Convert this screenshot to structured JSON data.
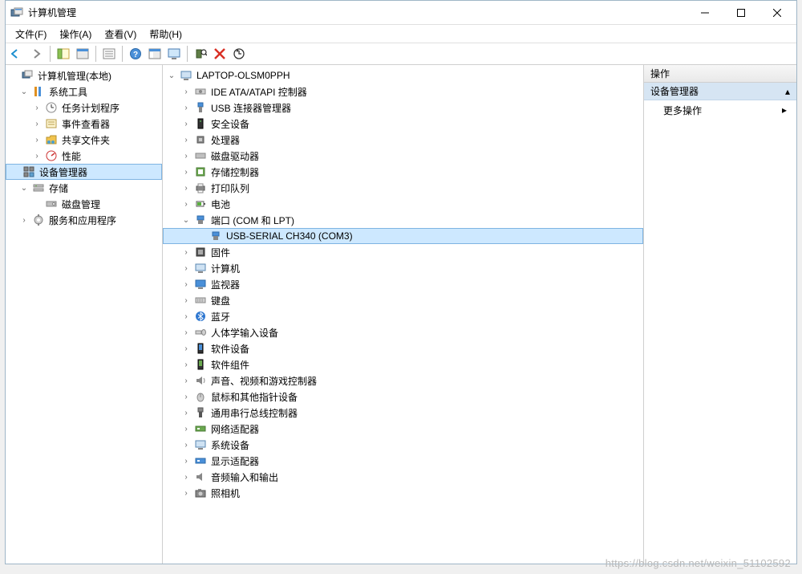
{
  "window": {
    "title": "计算机管理"
  },
  "menu": {
    "file": "文件(F)",
    "action": "操作(A)",
    "view": "查看(V)",
    "help": "帮助(H)"
  },
  "left_tree": {
    "root": "计算机管理(本地)",
    "system_tools": "系统工具",
    "task_scheduler": "任务计划程序",
    "event_viewer": "事件查看器",
    "shared_folders": "共享文件夹",
    "performance": "性能",
    "device_manager": "设备管理器",
    "storage": "存储",
    "disk_management": "磁盘管理",
    "services_apps": "服务和应用程序"
  },
  "device_tree": {
    "root": "LAPTOP-OLSM0PPH",
    "ide": "IDE ATA/ATAPI 控制器",
    "usb_connector": "USB 连接器管理器",
    "security_devices": "安全设备",
    "processors": "处理器",
    "disk_drives": "磁盘驱动器",
    "storage_controllers": "存储控制器",
    "print_queues": "打印队列",
    "batteries": "电池",
    "ports": "端口 (COM 和 LPT)",
    "usb_serial": "USB-SERIAL CH340 (COM3)",
    "firmware": "固件",
    "computer": "计算机",
    "monitors": "监视器",
    "keyboards": "键盘",
    "bluetooth": "蓝牙",
    "hid": "人体学输入设备",
    "software_devices": "软件设备",
    "software_components": "软件组件",
    "sound": "声音、视频和游戏控制器",
    "mice": "鼠标和其他指针设备",
    "usb_controllers": "通用串行总线控制器",
    "network_adapters": "网络适配器",
    "system_devices": "系统设备",
    "display_adapters": "显示适配器",
    "audio_io": "音频输入和输出",
    "cameras": "照相机"
  },
  "right_panel": {
    "header": "操作",
    "title": "设备管理器",
    "more_actions": "更多操作"
  },
  "watermark": "https://blog.csdn.net/weixin_51102592"
}
